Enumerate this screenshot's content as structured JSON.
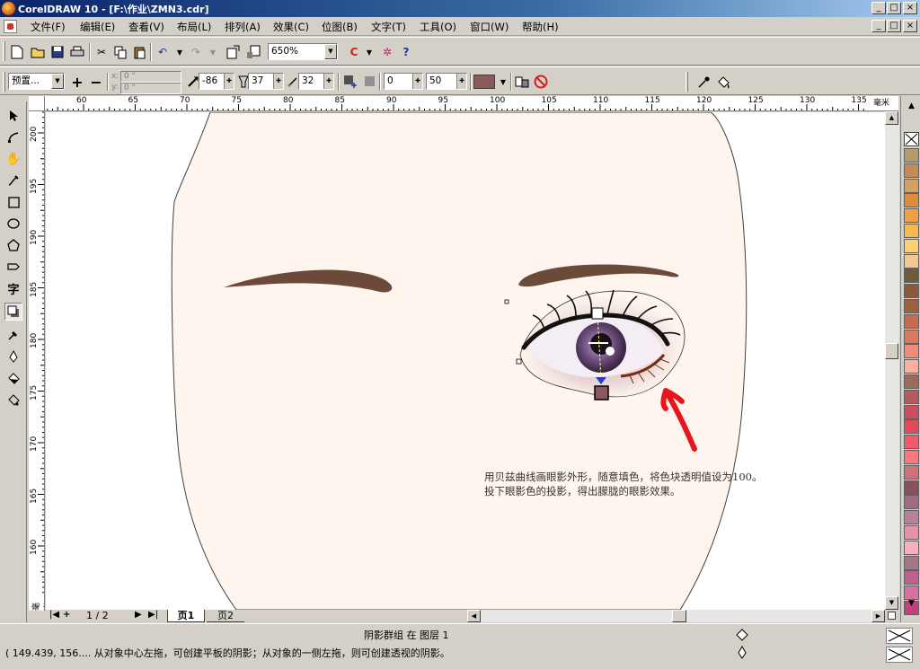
{
  "window": {
    "title": "CorelDRAW 10 - [F:\\作业\\ZMN3.cdr]",
    "caption_buttons": [
      "_",
      "□",
      "×"
    ],
    "doc_buttons": [
      "_",
      "□",
      "×"
    ]
  },
  "menu": {
    "items": [
      "文件(F)",
      "编辑(E)",
      "查看(V)",
      "布局(L)",
      "排列(A)",
      "效果(C)",
      "位图(B)",
      "文字(T)",
      "工具(O)",
      "窗口(W)",
      "帮助(H)"
    ]
  },
  "standard_toolbar": {
    "zoom_value": "650%"
  },
  "property_bar": {
    "preset_value": "预置...",
    "x_value": "0 \"",
    "y_value": "0 \"",
    "shadow_angle": "-86",
    "opacity": "37",
    "feather": "32",
    "stretch": "0",
    "fade": "50",
    "shadow_color": "#8a5a5a"
  },
  "ruler": {
    "unit": "毫米",
    "h_ticks": [
      "60",
      "65",
      "70",
      "75",
      "80",
      "85",
      "90",
      "95",
      "100",
      "105",
      "110",
      "115",
      "120",
      "125",
      "130",
      "135"
    ],
    "v_ticks": [
      "200",
      "195",
      "190",
      "185",
      "180",
      "175",
      "170",
      "165",
      "160"
    ],
    "v_unit": "毫米"
  },
  "canvas": {
    "face_color": "#fdf5ee",
    "brow_color": "#6b4a3a",
    "annotation_line1": "用贝兹曲线画眼影外形，随意填色，将色块透明值设为100。",
    "annotation_line2": "投下眼影色的投影，得出朦胧的眼影效果。",
    "arrow_color": "#e8161b"
  },
  "pages": {
    "counter": "1 / 2",
    "tabs": [
      "页1",
      "页2"
    ]
  },
  "palette": {
    "colors": [
      "#b59a6a",
      "#c58a55",
      "#d6a062",
      "#e08a3a",
      "#f0a040",
      "#f8b850",
      "#ffd070",
      "#f3c890",
      "#6e5a3c",
      "#8b5a3c",
      "#a0603c",
      "#c86a50",
      "#e07860",
      "#f08c78",
      "#f8b0a0",
      "#9c6a5a",
      "#b45a60",
      "#c85060",
      "#e04a5a",
      "#f05a6a",
      "#f87880",
      "#d0707a",
      "#8a5060",
      "#a06a80",
      "#b8809a",
      "#e890a8",
      "#f8b0c0",
      "#a07888",
      "#c06090",
      "#d870a0",
      "#c4407a"
    ]
  },
  "status": {
    "line1": "阴影群组 在 图层 1",
    "line2": "( 149.439, 156.... 从对象中心左拖，可创建平板的阴影；从对象的一侧左拖，则可创建透视的阴影。"
  }
}
